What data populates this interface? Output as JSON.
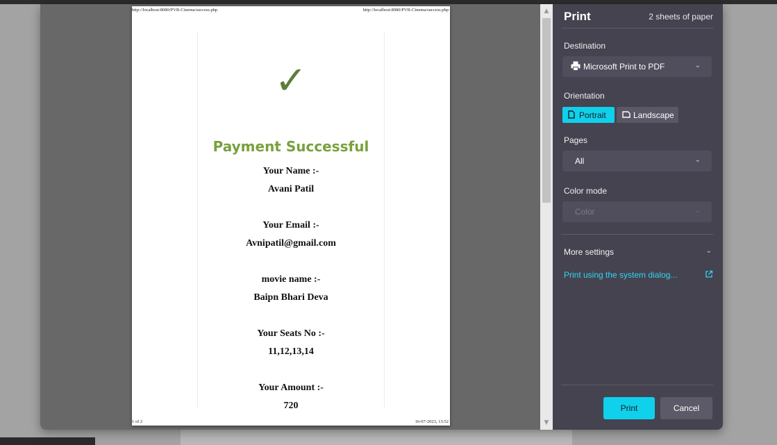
{
  "preview": {
    "header_left": "http://localhost:8080/PVR-Cinema/success.php",
    "header_right": "http://localhost:8080/PVR-Cinema/success.php",
    "footer_left": "1 of 2",
    "footer_right": "16-07-2023, 13:52",
    "checkmark": "✓",
    "title": "Payment Successful",
    "fields": [
      {
        "label": "Your Name :-",
        "value": "Avani Patil"
      },
      {
        "label": "Your Email :-",
        "value": "Avnipatil@gmail.com"
      },
      {
        "label": "movie name :-",
        "value": "Baipn Bhari Deva"
      },
      {
        "label": "Your Seats No :-",
        "value": "11,12,13,14"
      },
      {
        "label": "Your Amount :-",
        "value": "720"
      }
    ]
  },
  "panel": {
    "title": "Print",
    "sheets": "2 sheets of paper",
    "destination_label": "Destination",
    "destination_value": "Microsoft Print to PDF",
    "orientation_label": "Orientation",
    "orientation_portrait": "Portrait",
    "orientation_landscape": "Landscape",
    "pages_label": "Pages",
    "pages_value": "All",
    "color_label": "Color mode",
    "color_value": "Color",
    "more_settings": "More settings",
    "system_dialog": "Print using the system dialog...",
    "print_button": "Print",
    "cancel_button": "Cancel"
  },
  "colors": {
    "accent": "#0fd1ec",
    "panel_bg": "#454350",
    "title_green": "#78a13e"
  }
}
